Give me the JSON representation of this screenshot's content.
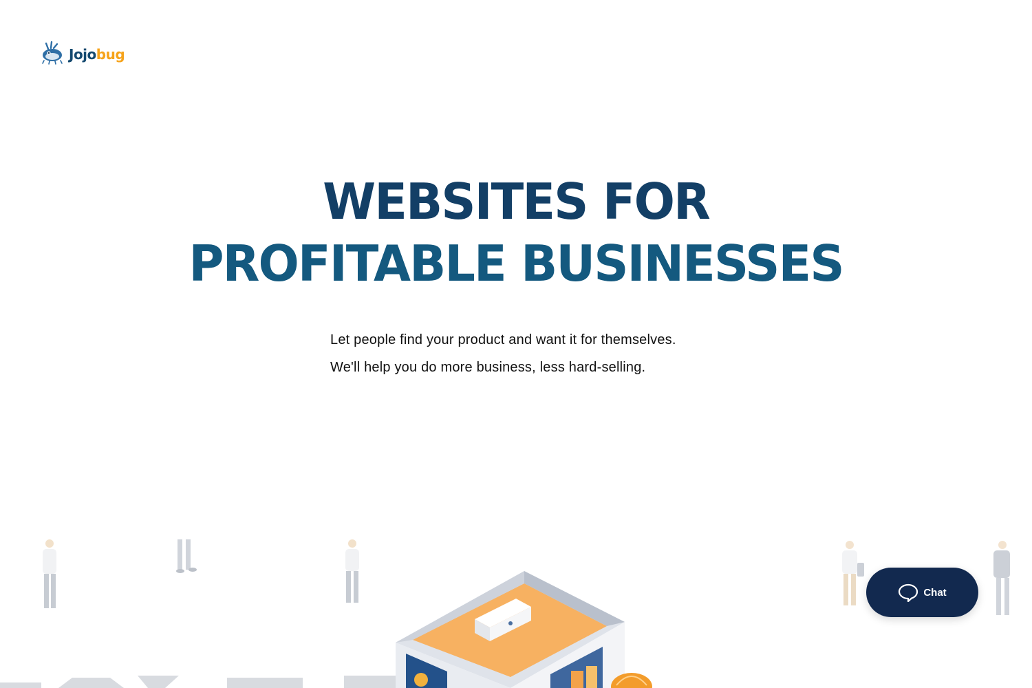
{
  "header": {
    "logo_text_part1": "Jojo",
    "logo_text_part2": "bug",
    "logo_icon": "bug-mascot-icon"
  },
  "hero": {
    "headline_line1": "WEBSITES FOR",
    "headline_line2": "PROFITABLE BUSINESSES",
    "subtext_line1": "Let people find your product and want it for themselves.",
    "subtext_line2": "We'll help you do more business, less hard-selling."
  },
  "chat": {
    "label": "Chat",
    "icon": "chat-bubble-icon"
  },
  "colors": {
    "headline_dark": "#133f66",
    "headline_mid": "#14597f",
    "logo_blue": "#14496f",
    "logo_orange": "#f6a31a",
    "chat_bg": "#12294f",
    "illustration_orange": "#f7b161",
    "illustration_gray": "#c9ccd2"
  }
}
